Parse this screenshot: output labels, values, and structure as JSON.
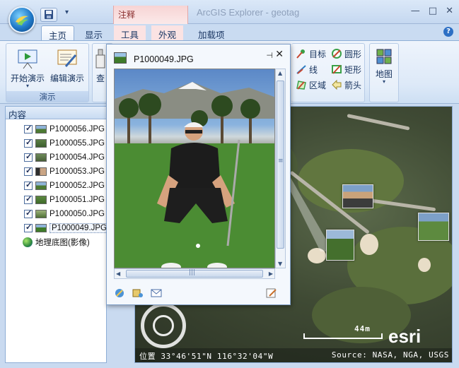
{
  "window": {
    "title": "ArcGIS Explorer - geotag",
    "context_tab_header": "注释",
    "controls": {
      "minimize": "—",
      "maximize": "□",
      "close": "✕"
    }
  },
  "qat": {
    "save_icon": "save-icon",
    "dropdown": "▾"
  },
  "tabs": [
    {
      "label": "主页",
      "active": true
    },
    {
      "label": "显示",
      "active": false
    },
    {
      "label": "工具",
      "active": false
    },
    {
      "label": "外观",
      "active": false
    },
    {
      "label": "加载项",
      "active": false
    }
  ],
  "help_label": "?",
  "ribbon": {
    "presentation_group": {
      "label": "演示",
      "start_label": "开始演示",
      "edit_label": "编辑演示"
    },
    "cut_label": "查",
    "annotation_group": {
      "target_label": "目标",
      "circle_label": "圆形",
      "line_label": "线",
      "rectangle_label": "矩形",
      "area_label": "区域",
      "arrow_label": "箭头"
    },
    "map_group": {
      "map_label": "地图"
    }
  },
  "contents_panel": {
    "title": "内容",
    "items": [
      {
        "label": "P1000056.JPG"
      },
      {
        "label": "P1000055.JPG"
      },
      {
        "label": "P1000054.JPG"
      },
      {
        "label": "P1000053.JPG"
      },
      {
        "label": "P1000052.JPG"
      },
      {
        "label": "P1000051.JPG"
      },
      {
        "label": "P1000050.JPG"
      },
      {
        "label": "P1000049.JPG"
      }
    ],
    "basemap_label": "地理底图(影像)"
  },
  "popup": {
    "title": "P1000049.JPG",
    "pin": "⊣",
    "close": "✕",
    "hscroll_grip": "|||",
    "vscroll_grip": "≡"
  },
  "map": {
    "scale_label": "44m",
    "brand": "esri",
    "status_location": "位置 33°46'51\"N  116°32'04\"W",
    "status_source": "Source: NASA, NGA, USGS"
  }
}
